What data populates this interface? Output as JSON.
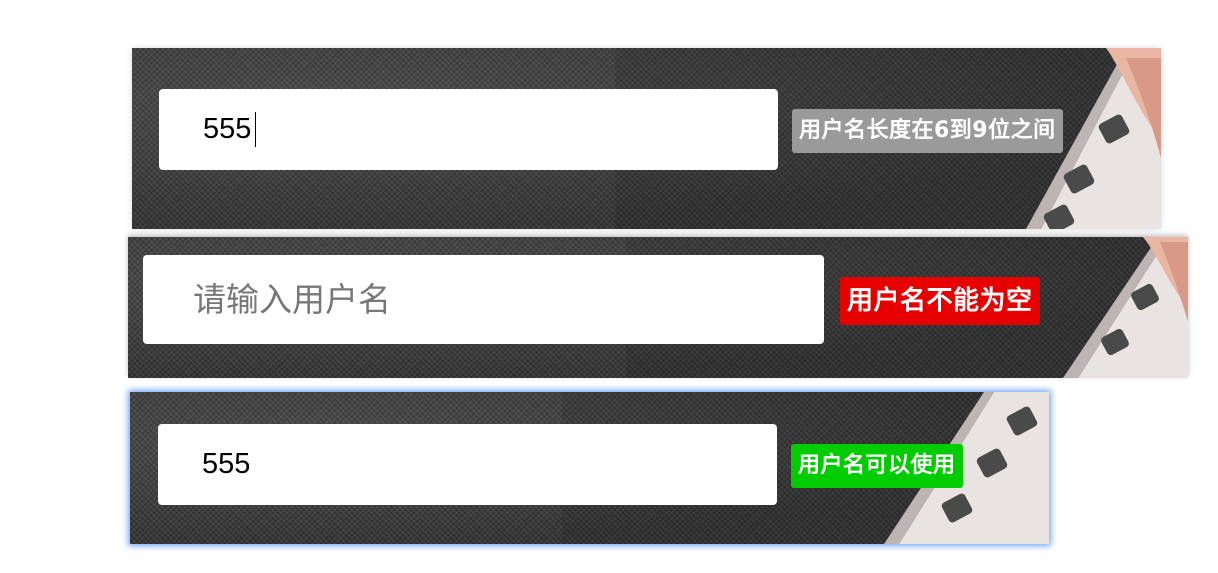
{
  "rows": [
    {
      "input_value": "555",
      "input_placeholder": "",
      "message": "用户名长度在6到9位之间",
      "message_color": "#9a9a9a",
      "state": "length-warning"
    },
    {
      "input_value": "",
      "input_placeholder": "请输入用户名",
      "message": "用户名不能为空",
      "message_color": "#e60000",
      "state": "error-empty"
    },
    {
      "input_value": "555",
      "input_placeholder": "",
      "message": "用户名可以使用",
      "message_color": "#00cc00",
      "state": "success"
    }
  ],
  "icons": [
    "keyboard-hand-image"
  ],
  "colors": {
    "panel_background": "#3b3b3b",
    "focus_glow": "#5a96ff"
  }
}
